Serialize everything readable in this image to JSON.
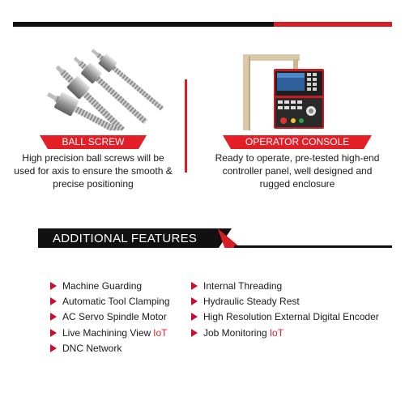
{
  "products": [
    {
      "label": "BALL SCREW",
      "description": [
        "High precision ball screws will be",
        "used for axis to ensure the smooth &",
        "precise positioning"
      ],
      "image_icon": "ball-screw-image"
    },
    {
      "label": "OPERATOR CONSOLE",
      "description": [
        "Ready to operate, pre-tested high-end",
        "controller panel, well designed and",
        "rugged enclosure"
      ],
      "image_icon": "operator-console-image"
    }
  ],
  "features_section": {
    "title": "ADDITIONAL FEATURES",
    "column1": [
      {
        "text": "Machine Guarding",
        "tag": ""
      },
      {
        "text": "Automatic Tool Clamping",
        "tag": ""
      },
      {
        "text": "AC Servo Spindle Motor",
        "tag": ""
      },
      {
        "text": "Live Machining View",
        "tag": "IoT"
      },
      {
        "text": "DNC Network",
        "tag": ""
      }
    ],
    "column2": [
      {
        "text": "Internal Threading",
        "tag": ""
      },
      {
        "text": "Hydraulic Steady Rest",
        "tag": ""
      },
      {
        "text": "High Resolution External Digital Encoder",
        "tag": ""
      },
      {
        "text": "Job Monitoring",
        "tag": "IoT"
      }
    ]
  },
  "colors": {
    "accent_red": "#e41e26",
    "dark": "#111111",
    "text": "#1a1a1a"
  }
}
